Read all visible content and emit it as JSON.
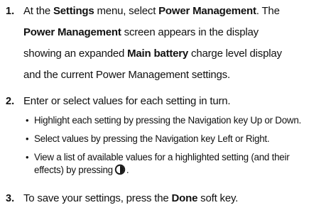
{
  "steps": [
    {
      "number": "1.",
      "parts": {
        "t1": "At the ",
        "b1": "Settings",
        "t2": " menu, select ",
        "b2": "Power Management",
        "t3": ". The",
        "b3": "Power Management",
        "t4": " screen appears in the display",
        "t5": "showing an expanded ",
        "b4": "Main battery",
        "t6": " charge level display",
        "t7": "and the current Power Management settings."
      }
    },
    {
      "number": "2.",
      "text": "Enter or select values for each setting in turn.",
      "bullets": [
        {
          "text": "Highlight each setting by pressing the Navigation key Up or Down."
        },
        {
          "text": "Select values by pressing the Navigation key Left or Right."
        },
        {
          "line1": "View a list of available values for a highlighted setting (and their",
          "line2_prefix": "effects) by pressing",
          "line2_suffix": ".",
          "icon": "navigation-center-key-icon"
        }
      ]
    },
    {
      "number": "3.",
      "parts": {
        "t1": "To save your settings, press the ",
        "b1": "Done",
        "t2": " soft key."
      }
    }
  ]
}
